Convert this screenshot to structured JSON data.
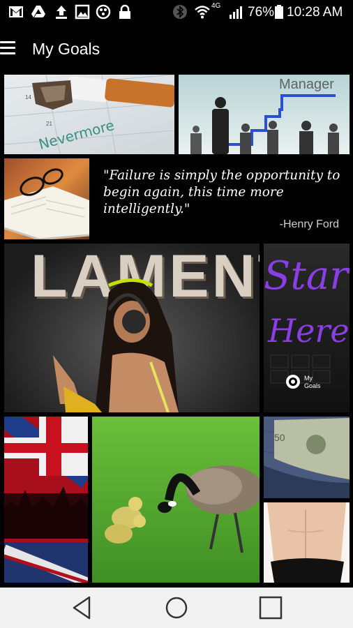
{
  "status_bar": {
    "battery": "76%",
    "time": "10:28 AM",
    "network": "4G",
    "left_icons": [
      "gmail-icon",
      "drive-icon",
      "upload-icon",
      "image-icon",
      "record-icon",
      "lock-icon"
    ],
    "right_icons": [
      "bluetooth-icon",
      "wifi-icon",
      "signal-icon",
      "battery-icon"
    ]
  },
  "app_bar": {
    "title": "My Goals",
    "menu_icon": "menu-icon"
  },
  "tiles": {
    "quit_smoking": {
      "caption": "Nevermore"
    },
    "manager": {
      "caption": "Manager"
    },
    "reading": {},
    "quote": {
      "text": "\"Failure is simply the opportunity to begin again, this time more intelligently.\"",
      "author": "-Henry Ford"
    },
    "lament": {
      "caption": "LAMENT"
    },
    "start_here": {
      "line1": "Start",
      "line2": "Here",
      "badge_line1": "My",
      "badge_line2": "Goals"
    },
    "uk_flag": {},
    "geese": {},
    "money": {},
    "abs": {}
  },
  "nav_bar": {
    "icons": [
      "back-icon",
      "home-icon",
      "recents-icon"
    ]
  },
  "colors": {
    "background": "#000000",
    "start_here_purple": "#8a3fe6",
    "manager_stairs": "#2a4fd0",
    "nav_bar": "#f2f2f2"
  }
}
